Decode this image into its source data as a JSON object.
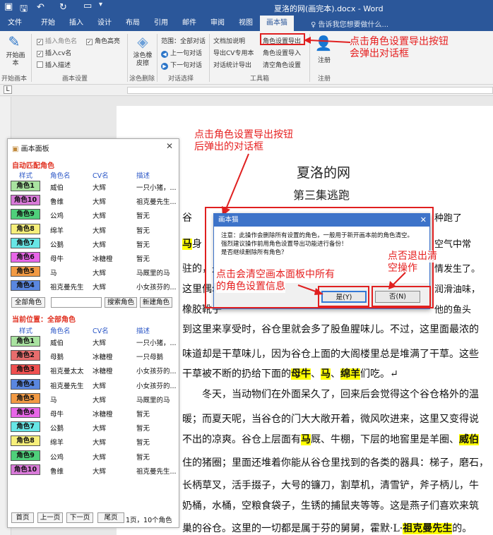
{
  "titlebar": {
    "title": "夏洛的网(画完本).docx - Word",
    "save_icon": "save-icon",
    "undo_icon": "undo-icon",
    "redo_icon": "redo-icon",
    "customize_icon": "customize-icon"
  },
  "ribbon_tabs": [
    "文件",
    "开始",
    "插入",
    "设计",
    "布局",
    "引用",
    "邮件",
    "审阅",
    "视图",
    "画本猫"
  ],
  "tell_me": "告诉我您想要做什么...",
  "ribbon": {
    "start_btn": "开始画本",
    "start_group": "开始画本",
    "insert_role_name": "插入角色名",
    "insert_cv_name": "插入cv名",
    "insert_desc": "插入描述",
    "role_highlight": "角色高亮",
    "settings_group": "画本设置",
    "erase_btn": "涂色橡皮擦",
    "erase_group": "涂色删除",
    "scope": "范围：全部对话",
    "prev_dialog": "上一句对话",
    "next_dialog": "下一句对话",
    "dialog_group": "对话选择",
    "doc_help": "文档加说明",
    "export_cv": "导出CV专用本",
    "dialog_stats": "对话统计导出",
    "export_roles": "角色设置导出",
    "import_roles": "角色设置导入",
    "clear_roles": "清空角色设置",
    "tools_group": "工具箱",
    "register_btn": "注册",
    "register_group": "注册"
  },
  "document": {
    "title": "夏洛的网",
    "subtitle": "第三集逃跑"
  },
  "panel": {
    "title": "画本面板",
    "auto_section": "自动匹配角色",
    "headers": [
      "样式",
      "角色名",
      "CV名",
      "描述"
    ],
    "auto_rows": [
      {
        "style": "角色1",
        "name": "威伯",
        "cv": "大辉",
        "desc": "一只小猪，...",
        "color": "#a9e3a0"
      },
      {
        "style": "角色10",
        "name": "鲁维",
        "cv": "大辉",
        "desc": "祖克曼先生...",
        "color": "#d97ad9"
      },
      {
        "style": "角色9",
        "name": "公鸡",
        "cv": "大辉",
        "desc": "暂无",
        "color": "#4fd07b"
      },
      {
        "style": "角色8",
        "name": "绵羊",
        "cv": "大辉",
        "desc": "暂无",
        "color": "#f6ef7a"
      },
      {
        "style": "角色7",
        "name": "公鹅",
        "cv": "大辉",
        "desc": "暂无",
        "color": "#67e6e6"
      },
      {
        "style": "角色6",
        "name": "母牛",
        "cv": "冰糖橙",
        "desc": "暂无",
        "color": "#e866e8"
      },
      {
        "style": "角色5",
        "name": "马",
        "cv": "大辉",
        "desc": "马厩里的马",
        "color": "#f29a44"
      },
      {
        "style": "角色4",
        "name": "祖克曼先生",
        "cv": "大辉",
        "desc": "小女孩芬的...",
        "color": "#5a87e0"
      }
    ],
    "all_roles_btn": "全部角色",
    "search_placeholder": "",
    "search_btn": "搜索角色",
    "new_btn": "新建角色",
    "current_section": "当前位置：全部角色",
    "current_rows": [
      {
        "style": "角色1",
        "name": "威伯",
        "cv": "大辉",
        "desc": "一只小猪，...",
        "color": "#a9e3a0"
      },
      {
        "style": "角色2",
        "name": "母鹅",
        "cv": "冰糖橙",
        "desc": "一只母鹅",
        "color": "#e86d6d"
      },
      {
        "style": "角色3",
        "name": "祖克曼太太",
        "cv": "冰糖橙",
        "desc": "小女孩芬的...",
        "color": "#ef5050"
      },
      {
        "style": "角色4",
        "name": "祖克曼先生",
        "cv": "大辉",
        "desc": "小女孩芬的...",
        "color": "#5a87e0"
      },
      {
        "style": "角色5",
        "name": "马",
        "cv": "大辉",
        "desc": "马厩里的马",
        "color": "#f29a44"
      },
      {
        "style": "角色6",
        "name": "母牛",
        "cv": "冰糖橙",
        "desc": "暂无",
        "color": "#e866e8"
      },
      {
        "style": "角色7",
        "name": "公鹅",
        "cv": "大辉",
        "desc": "暂无",
        "color": "#67e6e6"
      },
      {
        "style": "角色8",
        "name": "绵羊",
        "cv": "大辉",
        "desc": "暂无",
        "color": "#f6ef7a"
      },
      {
        "style": "角色9",
        "name": "公鸡",
        "cv": "大辉",
        "desc": "暂无",
        "color": "#4fd07b"
      },
      {
        "style": "角色10",
        "name": "鲁维",
        "cv": "大辉",
        "desc": "祖克曼先生...",
        "color": "#d97ad9"
      }
    ],
    "first_page": "首页",
    "prev_page": "上一页",
    "next_page": "下一页",
    "last_page": "尾页",
    "page_info": "1页，10个角色",
    "close_icon": "close-icon"
  },
  "dialog": {
    "title": "画本猫",
    "msg1": "注意：此操作会删除所有设置的角色，一般用于新开画本前的角色清空。",
    "msg2": "强烈建议操作前用角色设置导出功能进行备份！",
    "msg3": "是否继续删除所有角色？",
    "yes_btn": "是(Y)",
    "no_btn": "否(N)"
  },
  "annotations": {
    "top_right_1": "点击角色设置导出按钮",
    "top_right_2": "会弹出对话框",
    "mid_1": "点击角色设置导出按钮",
    "mid_2": "后弹出的对话框",
    "yes_1": "点击会清空画本面板中所有",
    "yes_2": "的角色设置信息",
    "no_1": "点否退出清",
    "no_2": "空操作"
  },
  "paragraphs": [
    {
      "segments": [
        {
          "t": "谷"
        }
      ],
      "tail": "种跑了"
    },
    {
      "segments": [
        {
          "t": "马",
          "hl": true
        },
        {
          "t": "身"
        }
      ],
      "tail": "空气中常"
    },
    {
      "segments": [
        {
          "t": "驻的，是"
        }
      ],
      "tail": "情发生了。"
    },
    {
      "segments": [
        {
          "t": "这里偶尔"
        }
      ],
      "tail": "润滑油味，"
    },
    {
      "segments": [
        {
          "t": "橡胶靴子"
        }
      ],
      "tail": "他的鱼头"
    },
    {
      "segments": [
        {
          "t": "到这里来享受时，谷仓里就会多了股鱼腥味儿。不过，这里面最浓的"
        }
      ],
      "tail": ""
    },
    {
      "segments": [
        {
          "t": "味道却是干草味儿，因为谷仓上面的大阁楼里总是堆满了干草。这些"
        }
      ],
      "tail": ""
    },
    {
      "segments": [
        {
          "t": "干草被不断的扔给下面的"
        },
        {
          "t": "母牛",
          "hl": true
        },
        {
          "t": "、"
        },
        {
          "t": "马",
          "hl": true
        },
        {
          "t": "、"
        },
        {
          "t": "绵羊",
          "hl": true
        },
        {
          "t": "们吃。↵"
        }
      ],
      "tail": ""
    },
    {
      "segments": [
        {
          "t": "　　冬天，当动物们在外面呆久了，回来后会觉得这个谷仓格外的温"
        }
      ],
      "tail": ""
    },
    {
      "segments": [
        {
          "t": "暖；而夏天呢，当谷仓的门大大敞开着，微风吹进来，这里又变得说"
        }
      ],
      "tail": ""
    },
    {
      "segments": [
        {
          "t": "不出的凉爽。谷仓上层面有"
        },
        {
          "t": "马",
          "hl": true
        },
        {
          "t": "厩、牛棚，下层的地窖里是羊圈、"
        },
        {
          "t": "威伯",
          "hl": true
        }
      ],
      "tail": ""
    },
    {
      "segments": [
        {
          "t": "住的猪圈；里面还堆着你能从谷仓里找到的各类的器具：梯子，磨石，"
        }
      ],
      "tail": ""
    },
    {
      "segments": [
        {
          "t": "长柄草叉，活手掇子，大号的镰刀，割草机，清雪铲，斧子柄儿，牛"
        }
      ],
      "tail": ""
    },
    {
      "segments": [
        {
          "t": "奶桶，水桶，空粮食袋子，生锈的捕鼠夹等等。这是燕子们喜欢来筑"
        }
      ],
      "tail": ""
    },
    {
      "segments": [
        {
          "t": "巢的谷仓。这里的一切都是属于芬的舅舅，霍默·L·"
        },
        {
          "t": "祖克曼先生",
          "hl": true
        },
        {
          "t": "的。"
        }
      ],
      "tail": ""
    }
  ]
}
